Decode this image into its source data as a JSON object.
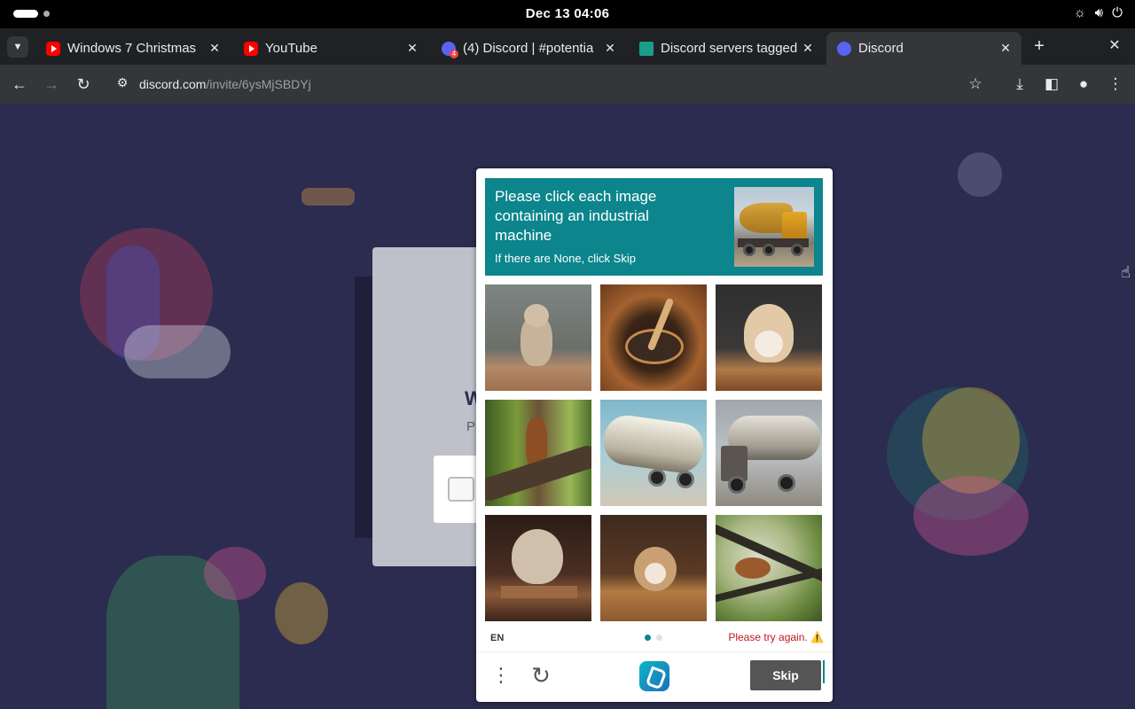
{
  "topbar": {
    "clock": "Dec 13  04:06",
    "tray_icons": [
      "brightness-icon",
      "volume-icon",
      "power-icon"
    ]
  },
  "tabs": [
    {
      "title": "Windows 7 Christmas",
      "favicon": "youtube-icon",
      "active": false
    },
    {
      "title": "YouTube",
      "favicon": "youtube-icon",
      "active": false
    },
    {
      "title": "(4) Discord | #potentia",
      "favicon": "discord-icon",
      "active": false
    },
    {
      "title": "Discord servers tagged",
      "favicon": "top-gg-icon",
      "active": false
    },
    {
      "title": "Discord",
      "favicon": "discord-icon",
      "active": true
    }
  ],
  "toolbar": {
    "url_host": "discord.com",
    "url_path": "/invite/6ysMjSBDYj"
  },
  "background_page": {
    "heading_fragment": "W",
    "sub_fragment": "P"
  },
  "captcha": {
    "prompt": "Please click each image containing an industrial machine",
    "prompt_sub": "If there are None, click Skip",
    "example_image": "concrete-mixer-truck",
    "tiles": [
      "hamster-standing",
      "wooden-spoon-bowl",
      "hamster-on-table",
      "squirrel-on-tree",
      "tanker-truck",
      "tanker-truck-side",
      "hamster-on-board",
      "hamster-on-table-2",
      "squirrel-in-branches"
    ],
    "language": "EN",
    "error": "Please try again. ⚠️",
    "skip_label": "Skip",
    "accent_color": "#0c858c",
    "error_color": "#bf1722"
  }
}
